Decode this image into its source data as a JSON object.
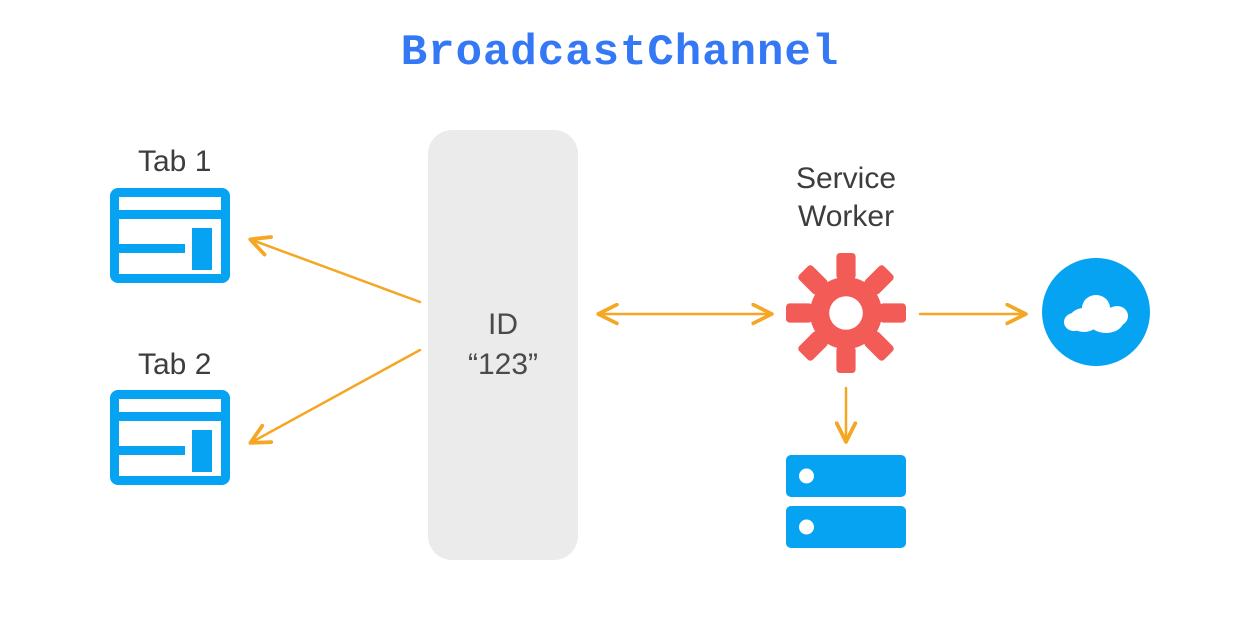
{
  "title": "BroadcastChannel",
  "tabs": [
    {
      "label": "Tab 1"
    },
    {
      "label": "Tab 2"
    }
  ],
  "channel": {
    "line1": "ID",
    "line2": "“123”"
  },
  "service_worker": {
    "label_line1": "Service",
    "label_line2": "Worker"
  },
  "icons": {
    "browser": "browser-window-icon",
    "gear": "gear-icon",
    "cloud": "cloud-icon",
    "database": "database-icon"
  },
  "colors": {
    "accent_blue": "#06a3f3",
    "title_blue": "#3478f6",
    "gear_red": "#f25b56",
    "arrow_orange": "#f5a623",
    "channel_bg": "#ebebeb",
    "text": "#3c3d3d"
  }
}
